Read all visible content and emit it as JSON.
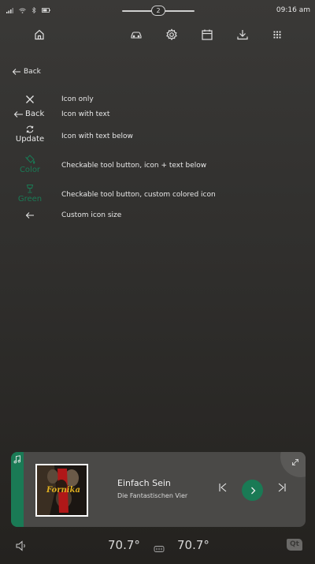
{
  "status_bar": {
    "time": "09:16 am",
    "handle_badge": "2",
    "icons": [
      "signal-icon",
      "wifi-icon",
      "bluetooth-icon",
      "battery-icon"
    ]
  },
  "nav": {
    "icons": [
      "home-icon",
      "car-icon",
      "gear-icon",
      "calendar-icon",
      "download-icon",
      "apps-grid-icon"
    ]
  },
  "back": {
    "label": "Back"
  },
  "rows": [
    {
      "button_label": "",
      "description": "Icon only"
    },
    {
      "button_label": "Back",
      "description": "Icon with text"
    },
    {
      "button_label": "Update",
      "description": "Icon with text below"
    },
    {
      "button_label": "Color",
      "description": "Checkable tool button, icon + text below"
    },
    {
      "button_label": "Green",
      "description": "Checkable tool button, custom colored icon"
    },
    {
      "button_label": "",
      "description": "Custom icon size"
    }
  ],
  "media": {
    "title": "Einfach Sein",
    "artist": "Die Fantastischen Vier",
    "album_text": "Fornika"
  },
  "climate": {
    "left_temp": "70.7°",
    "right_temp": "70.7°"
  },
  "brand": {
    "logo_text": "Qt"
  },
  "colors": {
    "accent": "#1a7a55",
    "text": "#e8e8e8",
    "card": "#4a4947"
  }
}
